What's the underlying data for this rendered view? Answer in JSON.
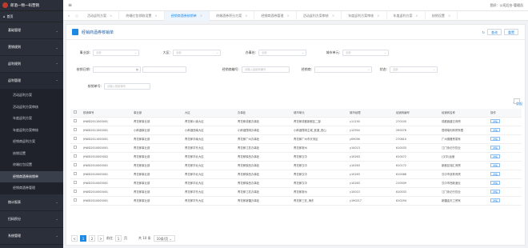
{
  "brand": {
    "name": "郎酒一物一码营销"
  },
  "sidebar": {
    "home": "首页",
    "groups": [
      {
        "label": "基础管理"
      },
      {
        "label": "营销规则"
      },
      {
        "label": "返利规则"
      },
      {
        "label": "返利管理"
      }
    ],
    "sub_items": [
      {
        "label": "活动返利方案"
      },
      {
        "label": "活动返利方案审核"
      },
      {
        "label": "年度返利方案"
      },
      {
        "label": "年度返利方案审核"
      },
      {
        "label": "经销商返利方案"
      },
      {
        "label": "核销设置"
      },
      {
        "label": "终端红包设置"
      },
      {
        "label": "经销商酒券核销单"
      },
      {
        "label": "经销商酒券管理"
      }
    ],
    "more_groups": [
      {
        "label": "统计报表"
      },
      {
        "label": "扫码积分"
      },
      {
        "label": "系统管理"
      }
    ]
  },
  "topbar": {
    "user": "您好：公司后台-管理员"
  },
  "tabs": [
    {
      "label": "活动返利方案"
    },
    {
      "label": "终端红包领取设置"
    },
    {
      "label": "经销商酒券核销单"
    },
    {
      "label": "终端酒券积分方案"
    },
    {
      "label": "经销商酒券管理"
    },
    {
      "label": "活动返利方案审核"
    },
    {
      "label": "年度返利方案审核"
    },
    {
      "label": "年度返利方案"
    },
    {
      "label": "核销设置"
    }
  ],
  "page": {
    "title": "经销商酒券核销单",
    "query_btn": "查询",
    "reset_btn": "重置",
    "collapse": "收起"
  },
  "filters": {
    "company": {
      "label": "事业部:",
      "placeholder": "全部"
    },
    "region": {
      "label": "大区:",
      "placeholder": "全部"
    },
    "office": {
      "label": "办事处:",
      "placeholder": "全部"
    },
    "city": {
      "label": "城市单元:",
      "placeholder": "全部"
    },
    "date": {
      "label": "核销日期:",
      "placeholder": ""
    },
    "dealer_code": {
      "label": "经销商编号:",
      "placeholder": "请输入经销商编号"
    },
    "dealer_name": {
      "label": "经销商:",
      "placeholder": ""
    },
    "status": {
      "label": "状态:",
      "placeholder": "全部"
    },
    "bill_no": {
      "label": "核销单号:",
      "placeholder": "请输入核销单号"
    }
  },
  "table": {
    "columns": [
      "核销单号",
      "事业部",
      "大区",
      "办事处",
      "城市单元",
      "城市经理",
      "经销商编号",
      "经销商名称",
      "操作"
    ],
    "rows": [
      [
        "JHWD2011000001",
        "青花郎事业部",
        "青花郎川渝大区",
        "青花郎成都办事处",
        "青花郎成都新都区二部",
        "y11230",
        "270100",
        "成都鑫盛达商贸",
        "详情"
      ],
      [
        "JHWD2011000001",
        "小郎酒事业部",
        "小郎酒西南大区",
        "小郎酒昆明办事处",
        "小郎酒昆明主城_官渡_西山",
        "y12954",
        "290076",
        "昆明瑞利商贸有限",
        "详情"
      ],
      [
        "JHWD2011000001",
        "青花郎事业部",
        "青花郎华南大区",
        "青花郎广州办事处",
        "青花郎广州市天河区",
        "y09056",
        "270810",
        "广州德隆贸易有",
        "详情"
      ],
      [
        "JHWD2010000001",
        "青花郎事业部",
        "青花郎华东大区",
        "青花郎江苏办事处",
        "青花郎常州",
        "y10013",
        "610033",
        "江门永记行饮业",
        "详情"
      ],
      [
        "JHWD2010000002",
        "青花郎事业部",
        "青花郎华北大区",
        "青花郎陕西办事处",
        "青花郎汉中",
        "y10263",
        "610472",
        "(汉中)运营",
        "详情"
      ],
      [
        "JHWD2010000001",
        "青花郎事业部",
        "青花郎华北大区",
        "青花郎陕西办事处",
        "青花郎汉中",
        "y10263",
        "610172",
        "新都区瑞汇商贸",
        "详情"
      ],
      [
        "JHWD2010000001",
        "青花郎事业部",
        "青花郎华北大区",
        "青花郎陕西办事处",
        "青花郎汉中",
        "y10263",
        "610066",
        "汉中市双林商贸",
        "详情"
      ],
      [
        "JHWD2010000001",
        "青花郎事业部",
        "青花郎华北大区",
        "青花郎陕西办事处",
        "青花郎汉中",
        "y10263",
        "210009",
        "汉中市西新酒业",
        "详情"
      ],
      [
        "JHWD2010000001",
        "青花郎事业部",
        "青花郎华东大区",
        "青花郎江苏办事处",
        "青花郎常州",
        "y10013",
        "610033",
        "江门永记行饮业",
        "详情"
      ],
      [
        "JHWD2010000001",
        "青花郎事业部",
        "青花郎华东大区",
        "青花郎新疆办事处",
        "青花郎三亚_海东",
        "y190217",
        "610294",
        "新疆金天工贸有",
        "详情"
      ]
    ]
  },
  "pager": {
    "prev": "<",
    "pages": [
      "1",
      "2"
    ],
    "next": ">",
    "goto_label": "前往",
    "goto_value": "1",
    "page_unit": "页",
    "total": "共 10 条",
    "size": "10条/页"
  },
  "colors": {
    "primary": "#1e88e5",
    "sidebar": "#2b2f3a"
  }
}
